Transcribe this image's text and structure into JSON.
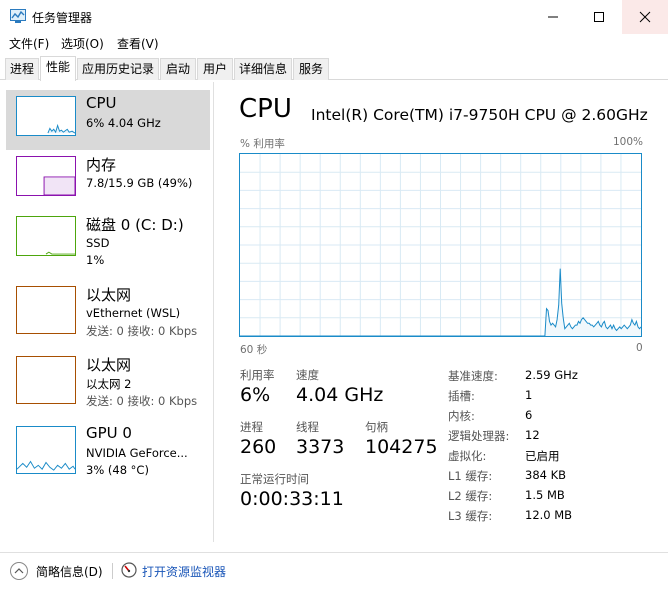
{
  "window": {
    "title": "任务管理器",
    "icons": [
      "task-manager-icon",
      "minimize-icon",
      "maximize-icon",
      "close-icon"
    ]
  },
  "menu": [
    "文件(F)",
    "选项(O)",
    "查看(V)"
  ],
  "tabs": [
    "进程",
    "性能",
    "应用历史记录",
    "启动",
    "用户",
    "详细信息",
    "服务"
  ],
  "active_tab": "性能",
  "sidebar": [
    {
      "title": "CPU",
      "line1": "6% 4.04 GHz",
      "line2": "",
      "color": "#1a8bc8"
    },
    {
      "title": "内存",
      "line1": "7.8/15.9 GB (49%)",
      "line2": "",
      "color": "#8b12ae"
    },
    {
      "title": "磁盘 0 (C: D:)",
      "line1": "SSD",
      "line2": "1%",
      "color": "#4da60c"
    },
    {
      "title": "以太网",
      "line1": "vEthernet (WSL)",
      "line2": "发送: 0 接收: 0 Kbps",
      "color": "#a74f01"
    },
    {
      "title": "以太网",
      "line1": "以太网 2",
      "line2": "发送: 0 接收: 0 Kbps",
      "color": "#a74f01"
    },
    {
      "title": "GPU 0",
      "line1": "NVIDIA GeForce...",
      "line2": "3% (48 °C)",
      "color": "#1a8bc8"
    }
  ],
  "cpu": {
    "title": "CPU",
    "model": "Intel(R) Core(TM) i7-9750H CPU @ 2.60GHz",
    "graph_label": "% 利用率",
    "graph_max": "100%",
    "graph_time": "60 秒",
    "graph_zero": "0",
    "usage_history": [
      0,
      0,
      0,
      0,
      0,
      0,
      0,
      0,
      0,
      0,
      0,
      0,
      0,
      0,
      0,
      0,
      0,
      0,
      0,
      0,
      0,
      0,
      0,
      0,
      0,
      0,
      0,
      0,
      0,
      0,
      0,
      0,
      0,
      0,
      0,
      0,
      0,
      0,
      0,
      0,
      0,
      0,
      0,
      0,
      0,
      0,
      0,
      0,
      0,
      0,
      0,
      0,
      0,
      0,
      0,
      0,
      0,
      0,
      0,
      0,
      0,
      0,
      0,
      0,
      0,
      0,
      0,
      0,
      0,
      0,
      0,
      0,
      0,
      0,
      0,
      0,
      0,
      0,
      0,
      0,
      0,
      0,
      0,
      0,
      0,
      0,
      0,
      0,
      0,
      0,
      0,
      0,
      0,
      0,
      0,
      0,
      0,
      0,
      0,
      0,
      0,
      0,
      0,
      0,
      0,
      0,
      0,
      0,
      0,
      0,
      0,
      0,
      0,
      0,
      0,
      0,
      0,
      0,
      0,
      0,
      0,
      0,
      0,
      0,
      0,
      0,
      0,
      0,
      0,
      0,
      0,
      0,
      0,
      0,
      0,
      0,
      0,
      0,
      0,
      0,
      0,
      0,
      0,
      0,
      0,
      0,
      0,
      0,
      0,
      0,
      0,
      0,
      0,
      0,
      0,
      0,
      0,
      0,
      0,
      0,
      0,
      0,
      0,
      0,
      0,
      0,
      0,
      0,
      0,
      0,
      0,
      0,
      0,
      0,
      0,
      0,
      0,
      0,
      0,
      0,
      0,
      0,
      0,
      0,
      0,
      0,
      0,
      0,
      0,
      0,
      0,
      0,
      0,
      0,
      0,
      0,
      0,
      0,
      0,
      0,
      0,
      15,
      14,
      8,
      6,
      7,
      6,
      5,
      9,
      17,
      37,
      18,
      10,
      4,
      5,
      6,
      7,
      5,
      4,
      5,
      6,
      6,
      8,
      7,
      9,
      10,
      9,
      8,
      7,
      7,
      6,
      6,
      5,
      6,
      7,
      8,
      6,
      5,
      7,
      8,
      5,
      4,
      5,
      6,
      4,
      6,
      4,
      3,
      4,
      5,
      4,
      5,
      6,
      5,
      4,
      5,
      6,
      9,
      7,
      6,
      8,
      5,
      4,
      5
    ],
    "utilization_label": "利用率",
    "utilization": "6%",
    "speed_label": "速度",
    "speed": "4.04 GHz",
    "processes_label": "进程",
    "processes": "260",
    "threads_label": "线程",
    "threads": "3373",
    "handles_label": "句柄",
    "handles": "104275",
    "uptime_label": "正常运行时间",
    "uptime": "0:00:33:11",
    "details": [
      {
        "key": "基准速度:",
        "value": "2.59 GHz"
      },
      {
        "key": "插槽:",
        "value": "1"
      },
      {
        "key": "内核:",
        "value": "6"
      },
      {
        "key": "逻辑处理器:",
        "value": "12"
      },
      {
        "key": "虚拟化:",
        "value": "已启用"
      },
      {
        "key": "L1 缓存:",
        "value": "384 KB"
      },
      {
        "key": "L2 缓存:",
        "value": "1.5 MB"
      },
      {
        "key": "L3 缓存:",
        "value": "12.0 MB"
      }
    ]
  },
  "footer": {
    "collapse_label": "简略信息(D)",
    "resmon_link": "打开资源监视器"
  }
}
